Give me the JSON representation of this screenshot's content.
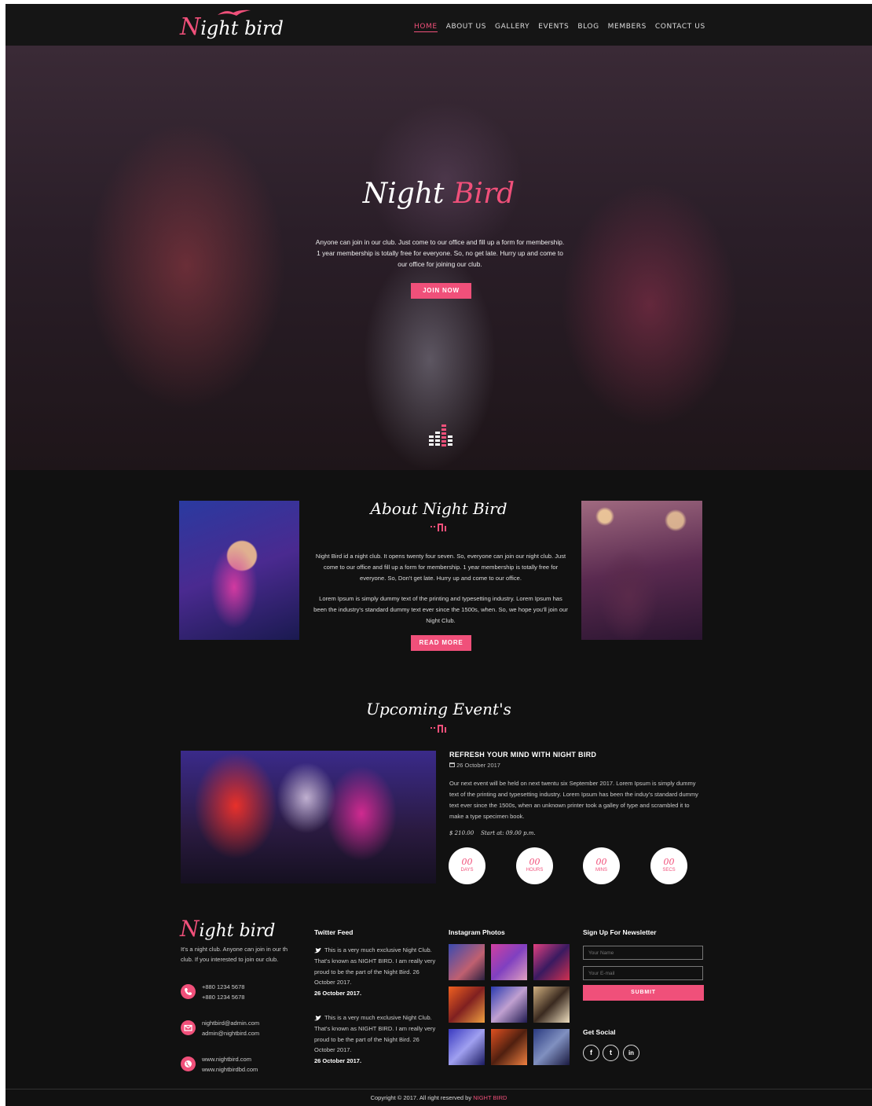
{
  "header": {
    "logo_cap": "N",
    "logo_rest": "ight bird",
    "nav": [
      "HOME",
      "ABOUT US",
      "GALLERY",
      "EVENTS",
      "BLOG",
      "MEMBERS",
      "CONTACT US"
    ]
  },
  "hero": {
    "title_a": "Night",
    "title_b": "Bird",
    "text": "Anyone can join in our club. Just come to our office and fill up a form for membership. 1 year membership is totally free for everyone. So, no get late. Hurry up and come to our office for joining our club.",
    "button": "JOIN NOW"
  },
  "about": {
    "title": "About Night Bird",
    "p1": "Night Bird id a night club. It opens twenty four seven. So, everyone can join our night club. Just come to our office and fill up a form for membership. 1 year membership is totally free for everyone. So, Don't get late. Hurry up and come to our office.",
    "p2": "Lorem Ipsum is simply dummy text of the printing and typesetting industry. Lorem Ipsum has been the industry's standard dummy text ever since the 1500s, when. So, we hope you'll join our Night Club.",
    "button": "READ MORE"
  },
  "events": {
    "title": "Upcoming Event's",
    "event_title": "REFRESH YOUR MIND WITH NIGHT BIRD",
    "event_date": "26 October 2017",
    "event_desc": "Our next event will be held on next twentu six September 2017. Lorem Ipsum is simply dummy text of the printing and typesetting industry. Lorem Ipsum has been the induy's standard dummy text ever since the 1500s, when an unknown printer took a galley of type and scrambled it to make a type specimen book.",
    "price": "$ 210.00",
    "start": "Start at: 09.00 p.m.",
    "countdown": [
      {
        "num": "00",
        "unit": "DAYS"
      },
      {
        "num": "00",
        "unit": "HOURS"
      },
      {
        "num": "00",
        "unit": "MINS"
      },
      {
        "num": "00",
        "unit": "SECS"
      }
    ]
  },
  "footer": {
    "logo_cap": "N",
    "logo_rest": "ight bird",
    "desc": "It's a night club. Anyone can join in our th club. If you interested to join our club.",
    "phone1": "+880 1234 5678",
    "phone2": "+880 1234 5678",
    "email1": "nightbird@admin.com",
    "email2": "admin@nightbird.com",
    "web1": "www.nightbird.com",
    "web2": "www.nightbirdbd.com",
    "twitter_heading": "Twitter Feed",
    "tweet1_text": "This is a very much exclusive Night Club. That's known as NIGHT BIRD. I am really very proud to be the part of the Night Bird. 26 October 2017.",
    "tweet1_date": "26 October 2017.",
    "tweet2_text": "This is a very much exclusive Night Club. That's known as NIGHT BIRD. I am really very proud to be the part of the Night Bird. 26 October 2017.",
    "tweet2_date": "26 October 2017.",
    "instagram_heading": "Instagram Photos",
    "newsletter_heading": "Sign Up For Newsletter",
    "name_placeholder": "Your Name",
    "email_placeholder": "Your E-mail",
    "submit": "SUBMIT",
    "social_heading": "Get Social",
    "social": [
      "f",
      "t",
      "in"
    ],
    "copyright": "Copyright © 2017. All right reserved by",
    "copyright_brand": "NIGHT BIRD"
  },
  "colors": {
    "accent": "#f0507a",
    "background": "#111111"
  }
}
